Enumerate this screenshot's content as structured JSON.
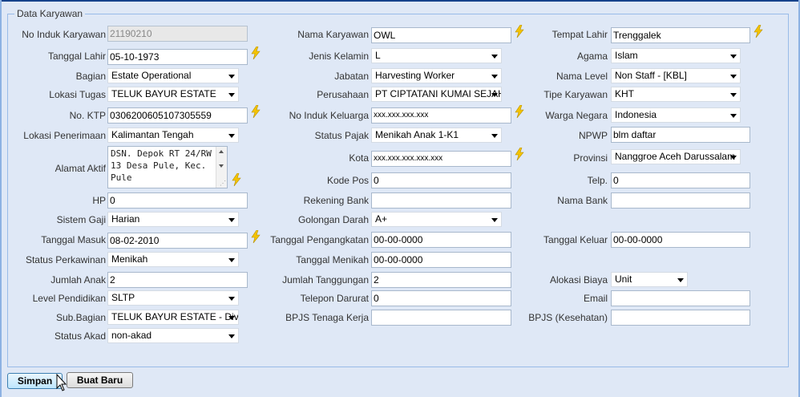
{
  "form": {
    "legend": "Data Karyawan",
    "fields": {
      "no_induk_karyawan": {
        "label": "No Induk Karyawan",
        "value": "21190210"
      },
      "nama_karyawan": {
        "label": "Nama Karyawan",
        "value": "OWL"
      },
      "tempat_lahir": {
        "label": "Tempat Lahir",
        "value": "Trenggalek"
      },
      "tanggal_lahir": {
        "label": "Tanggal Lahir",
        "value": "05-10-1973"
      },
      "jenis_kelamin": {
        "label": "Jenis Kelamin",
        "value": "L"
      },
      "agama": {
        "label": "Agama",
        "value": "Islam"
      },
      "bagian": {
        "label": "Bagian",
        "value": "Estate Operational"
      },
      "jabatan": {
        "label": "Jabatan",
        "value": "Harvesting Worker"
      },
      "nama_level": {
        "label": "Nama Level",
        "value": "Non Staff - [KBL]"
      },
      "lokasi_tugas": {
        "label": "Lokasi Tugas",
        "value": "TELUK BAYUR ESTATE"
      },
      "perusahaan": {
        "label": "Perusahaan",
        "value": "PT CIPTATANI KUMAI SEJAHTERA"
      },
      "tipe_karyawan": {
        "label": "Tipe Karyawan",
        "value": "KHT"
      },
      "no_ktp": {
        "label": "No. KTP",
        "value": "0306200605107305559"
      },
      "no_induk_keluarga": {
        "label": "No Induk Keluarga",
        "value": "xxx.xxx.xxx.xxx"
      },
      "warga_negara": {
        "label": "Warga Negara",
        "value": "Indonesia"
      },
      "lokasi_penerimaan": {
        "label": "Lokasi Penerimaan",
        "value": "Kalimantan Tengah"
      },
      "status_pajak": {
        "label": "Status Pajak",
        "value": "Menikah Anak 1-K1"
      },
      "npwp": {
        "label": "NPWP",
        "value": "blm daftar"
      },
      "alamat_aktif": {
        "label": "Alamat Aktif",
        "value": "DSN. Depok RT 24/RW 13 Desa Pule, Kec. Pule"
      },
      "kota": {
        "label": "Kota",
        "value": "xxx.xxx.xxx.xxx.xxx"
      },
      "provinsi": {
        "label": "Provinsi",
        "value": "Nanggroe Aceh Darussalam"
      },
      "kode_pos": {
        "label": "Kode Pos",
        "value": "0"
      },
      "telp": {
        "label": "Telp.",
        "value": "0"
      },
      "hp": {
        "label": "HP",
        "value": "0"
      },
      "rekening_bank": {
        "label": "Rekening Bank",
        "value": ""
      },
      "nama_bank": {
        "label": "Nama Bank",
        "value": ""
      },
      "sistem_gaji": {
        "label": "Sistem Gaji",
        "value": "Harian"
      },
      "golongan_darah": {
        "label": "Golongan Darah",
        "value": "A+"
      },
      "tanggal_masuk": {
        "label": "Tanggal Masuk",
        "value": "08-02-2010"
      },
      "tanggal_pengangkatan": {
        "label": "Tanggal Pengangkatan",
        "value": "00-00-0000"
      },
      "tanggal_keluar": {
        "label": "Tanggal Keluar",
        "value": "00-00-0000"
      },
      "status_perkawinan": {
        "label": "Status Perkawinan",
        "value": "Menikah"
      },
      "tanggal_menikah": {
        "label": "Tanggal Menikah",
        "value": "00-00-0000"
      },
      "jumlah_anak": {
        "label": "Jumlah Anak",
        "value": "2"
      },
      "jumlah_tanggungan": {
        "label": "Jumlah Tanggungan",
        "value": "2"
      },
      "alokasi_biaya": {
        "label": "Alokasi Biaya",
        "value": "Unit"
      },
      "level_pendidikan": {
        "label": "Level Pendidikan",
        "value": "SLTP"
      },
      "telepon_darurat": {
        "label": "Telepon Darurat",
        "value": "0"
      },
      "email": {
        "label": "Email",
        "value": ""
      },
      "sub_bagian": {
        "label": "Sub.Bagian",
        "value": "TELUK BAYUR ESTATE - Divisi"
      },
      "bpjs_tenaga_kerja": {
        "label": "BPJS Tenaga Kerja",
        "value": ""
      },
      "bpjs_kesehatan": {
        "label": "BPJS (Kesehatan)",
        "value": ""
      },
      "status_akad": {
        "label": "Status Akad",
        "value": "non-akad"
      }
    }
  },
  "buttons": {
    "simpan": "Simpan",
    "buat_baru": "Buat Baru"
  },
  "colors": {
    "background": "#dfe8f6",
    "border": "#99bbe8",
    "lightning": "#f5c400"
  },
  "icons": {
    "lightning": "lightning-bolt-icon",
    "cursor": "mouse-pointer-icon"
  }
}
